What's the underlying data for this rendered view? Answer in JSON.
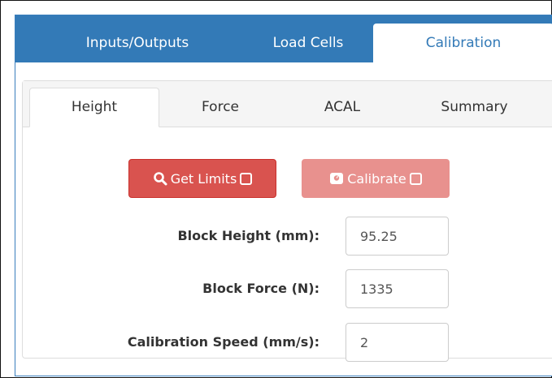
{
  "top_tabs": [
    {
      "label": "Inputs/Outputs",
      "active": false
    },
    {
      "label": "Load Cells",
      "active": false
    },
    {
      "label": "Calibration",
      "active": true
    }
  ],
  "sub_tabs": [
    {
      "label": "Height",
      "active": true
    },
    {
      "label": "Force",
      "active": false
    },
    {
      "label": "ACAL",
      "active": false
    },
    {
      "label": "Summary",
      "active": false
    }
  ],
  "buttons": {
    "get_limits": {
      "label": "Get Limits",
      "icon": "search-icon",
      "enabled": true
    },
    "calibrate": {
      "label": "Calibrate",
      "icon": "scale-icon",
      "enabled": false
    }
  },
  "fields": [
    {
      "label": "Block Height (mm):",
      "value": "95.25"
    },
    {
      "label": "Block Force (N):",
      "value": "1335"
    },
    {
      "label": "Calibration Speed (mm/s):",
      "value": "2"
    }
  ],
  "colors": {
    "primary": "#337ab7",
    "danger": "#d9534f",
    "danger_disabled": "#e8918e"
  }
}
